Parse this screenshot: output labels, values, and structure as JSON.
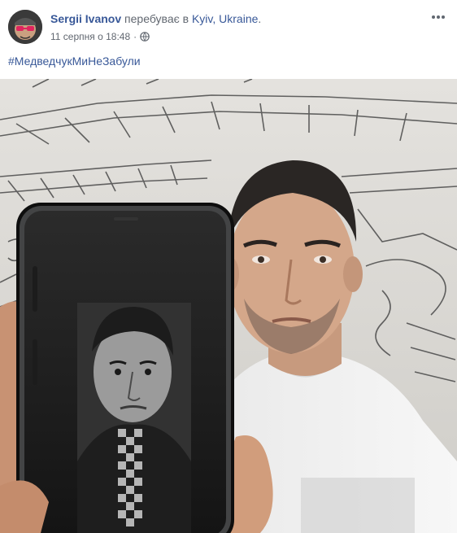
{
  "post": {
    "author": {
      "name": "Sergii Ivanov",
      "action": " перебуває в ",
      "place": "Kyiv, Ukraine",
      "place_suffix": "."
    },
    "timestamp": "11 серпня о 18:48",
    "separator": "·",
    "privacy_icon": "globe-icon",
    "more_icon": "more-dots-icon",
    "hashtag": "#МедведчукМиНеЗабули",
    "photo": {
      "subject": "selfie-with-phone-photo"
    }
  },
  "colors": {
    "link": "#385898",
    "secondary_text": "#616770",
    "primary_text": "#1d2129"
  }
}
